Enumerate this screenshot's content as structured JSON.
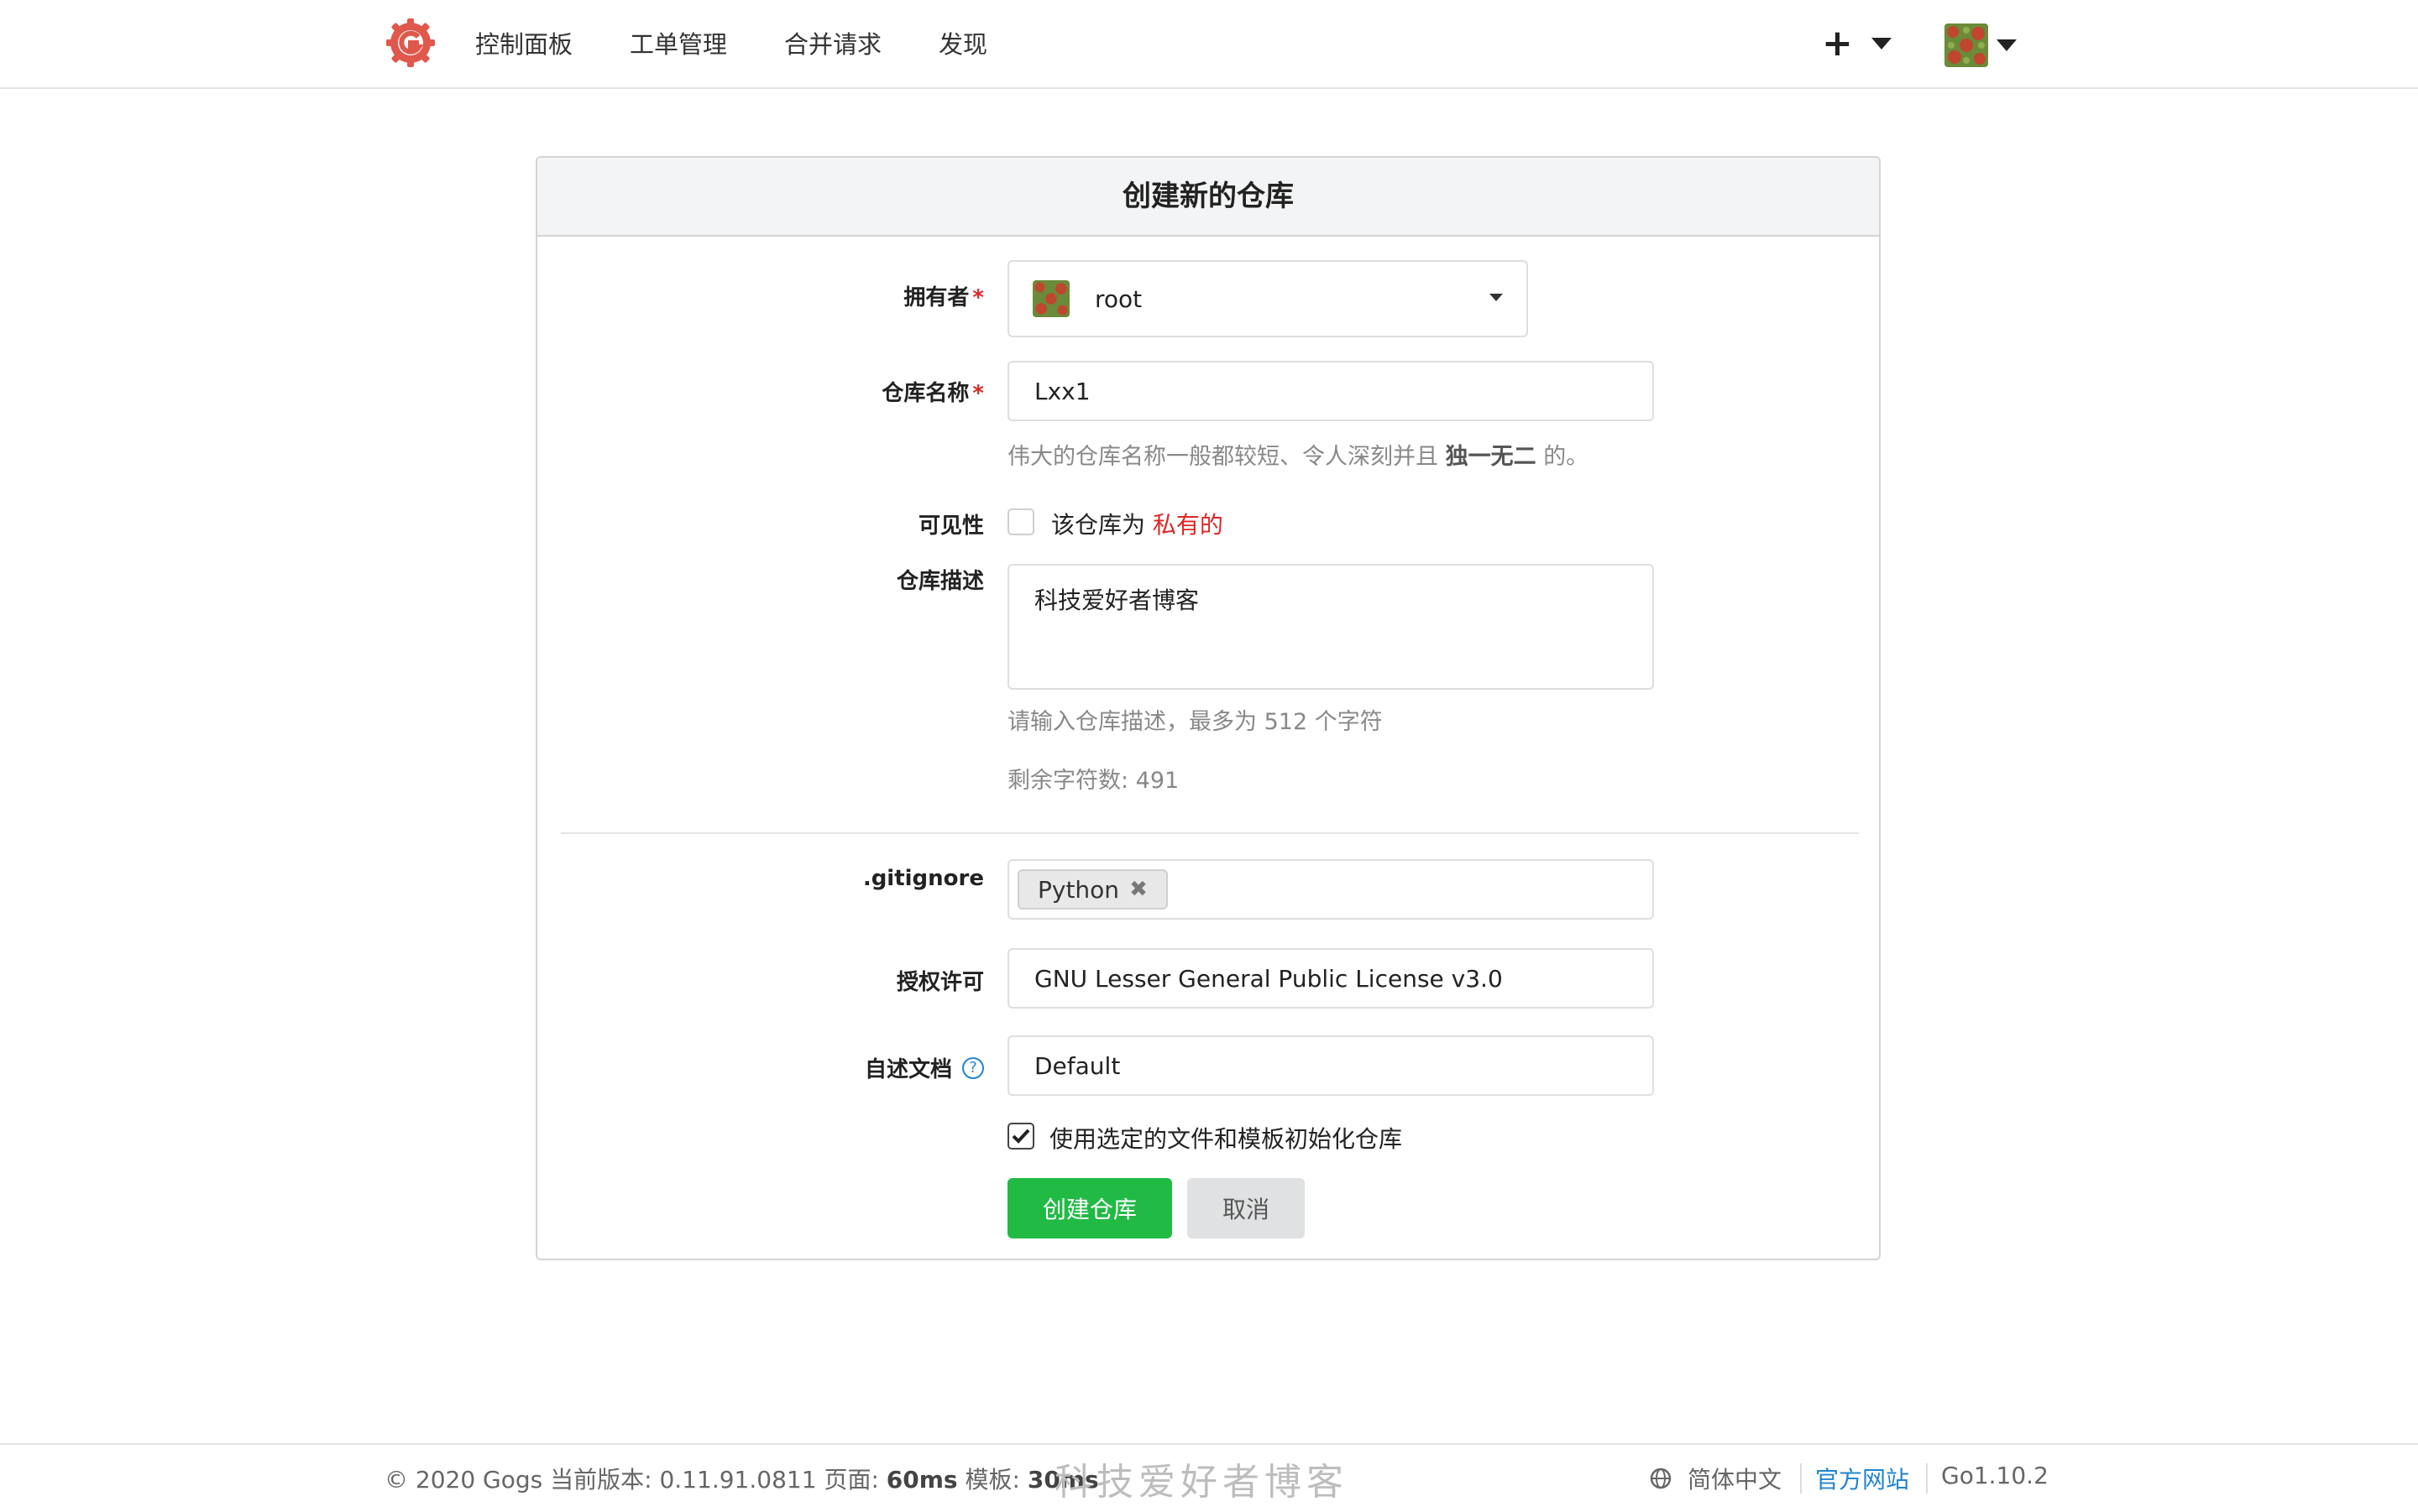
{
  "nav": {
    "items": [
      "控制面板",
      "工单管理",
      "合并请求",
      "发现"
    ],
    "plus_icon": "+"
  },
  "form": {
    "title": "创建新的仓库",
    "owner": {
      "label": "拥有者",
      "value": "root"
    },
    "repo_name": {
      "label": "仓库名称",
      "value": "Lxx1"
    },
    "repo_name_help": {
      "prefix": "伟大的仓库名称一般都较短、令人深刻并且",
      "emphasis": "独一无二",
      "suffix": "的。"
    },
    "visibility": {
      "label": "可见性",
      "text": "该仓库为",
      "private_text": "私有的",
      "checked": false
    },
    "description": {
      "label": "仓库描述",
      "value": "科技爱好者博客",
      "help": "请输入仓库描述，最多为 512 个字符",
      "remaining": "剩余字符数: 491"
    },
    "gitignore": {
      "label": ".gitignore",
      "tag": "Python",
      "remove_icon": "✖"
    },
    "license": {
      "label": "授权许可",
      "value": "GNU Lesser General Public License v3.0"
    },
    "readme": {
      "label": "自述文档",
      "value": "Default",
      "help_icon": "?"
    },
    "auto_init": {
      "text": "使用选定的文件和模板初始化仓库",
      "checked": true
    },
    "buttons": {
      "create": "创建仓库",
      "cancel": "取消"
    },
    "required_mark": "*"
  },
  "footer": {
    "copyright": "© 2020 Gogs",
    "version_label": "当前版本: 0.11.91.0811",
    "page_label": "页面:",
    "page_time": "60ms",
    "template_label": "模板:",
    "template_time": "30ms",
    "watermark": "科技爱好者博客",
    "language": "简体中文",
    "official_site": "官方网站",
    "go_version": "Go1.10.2"
  },
  "colors": {
    "accent_green": "#21ba45",
    "required_red": "#db2828",
    "link_blue": "#2185d0",
    "logo": "#e0584c"
  }
}
